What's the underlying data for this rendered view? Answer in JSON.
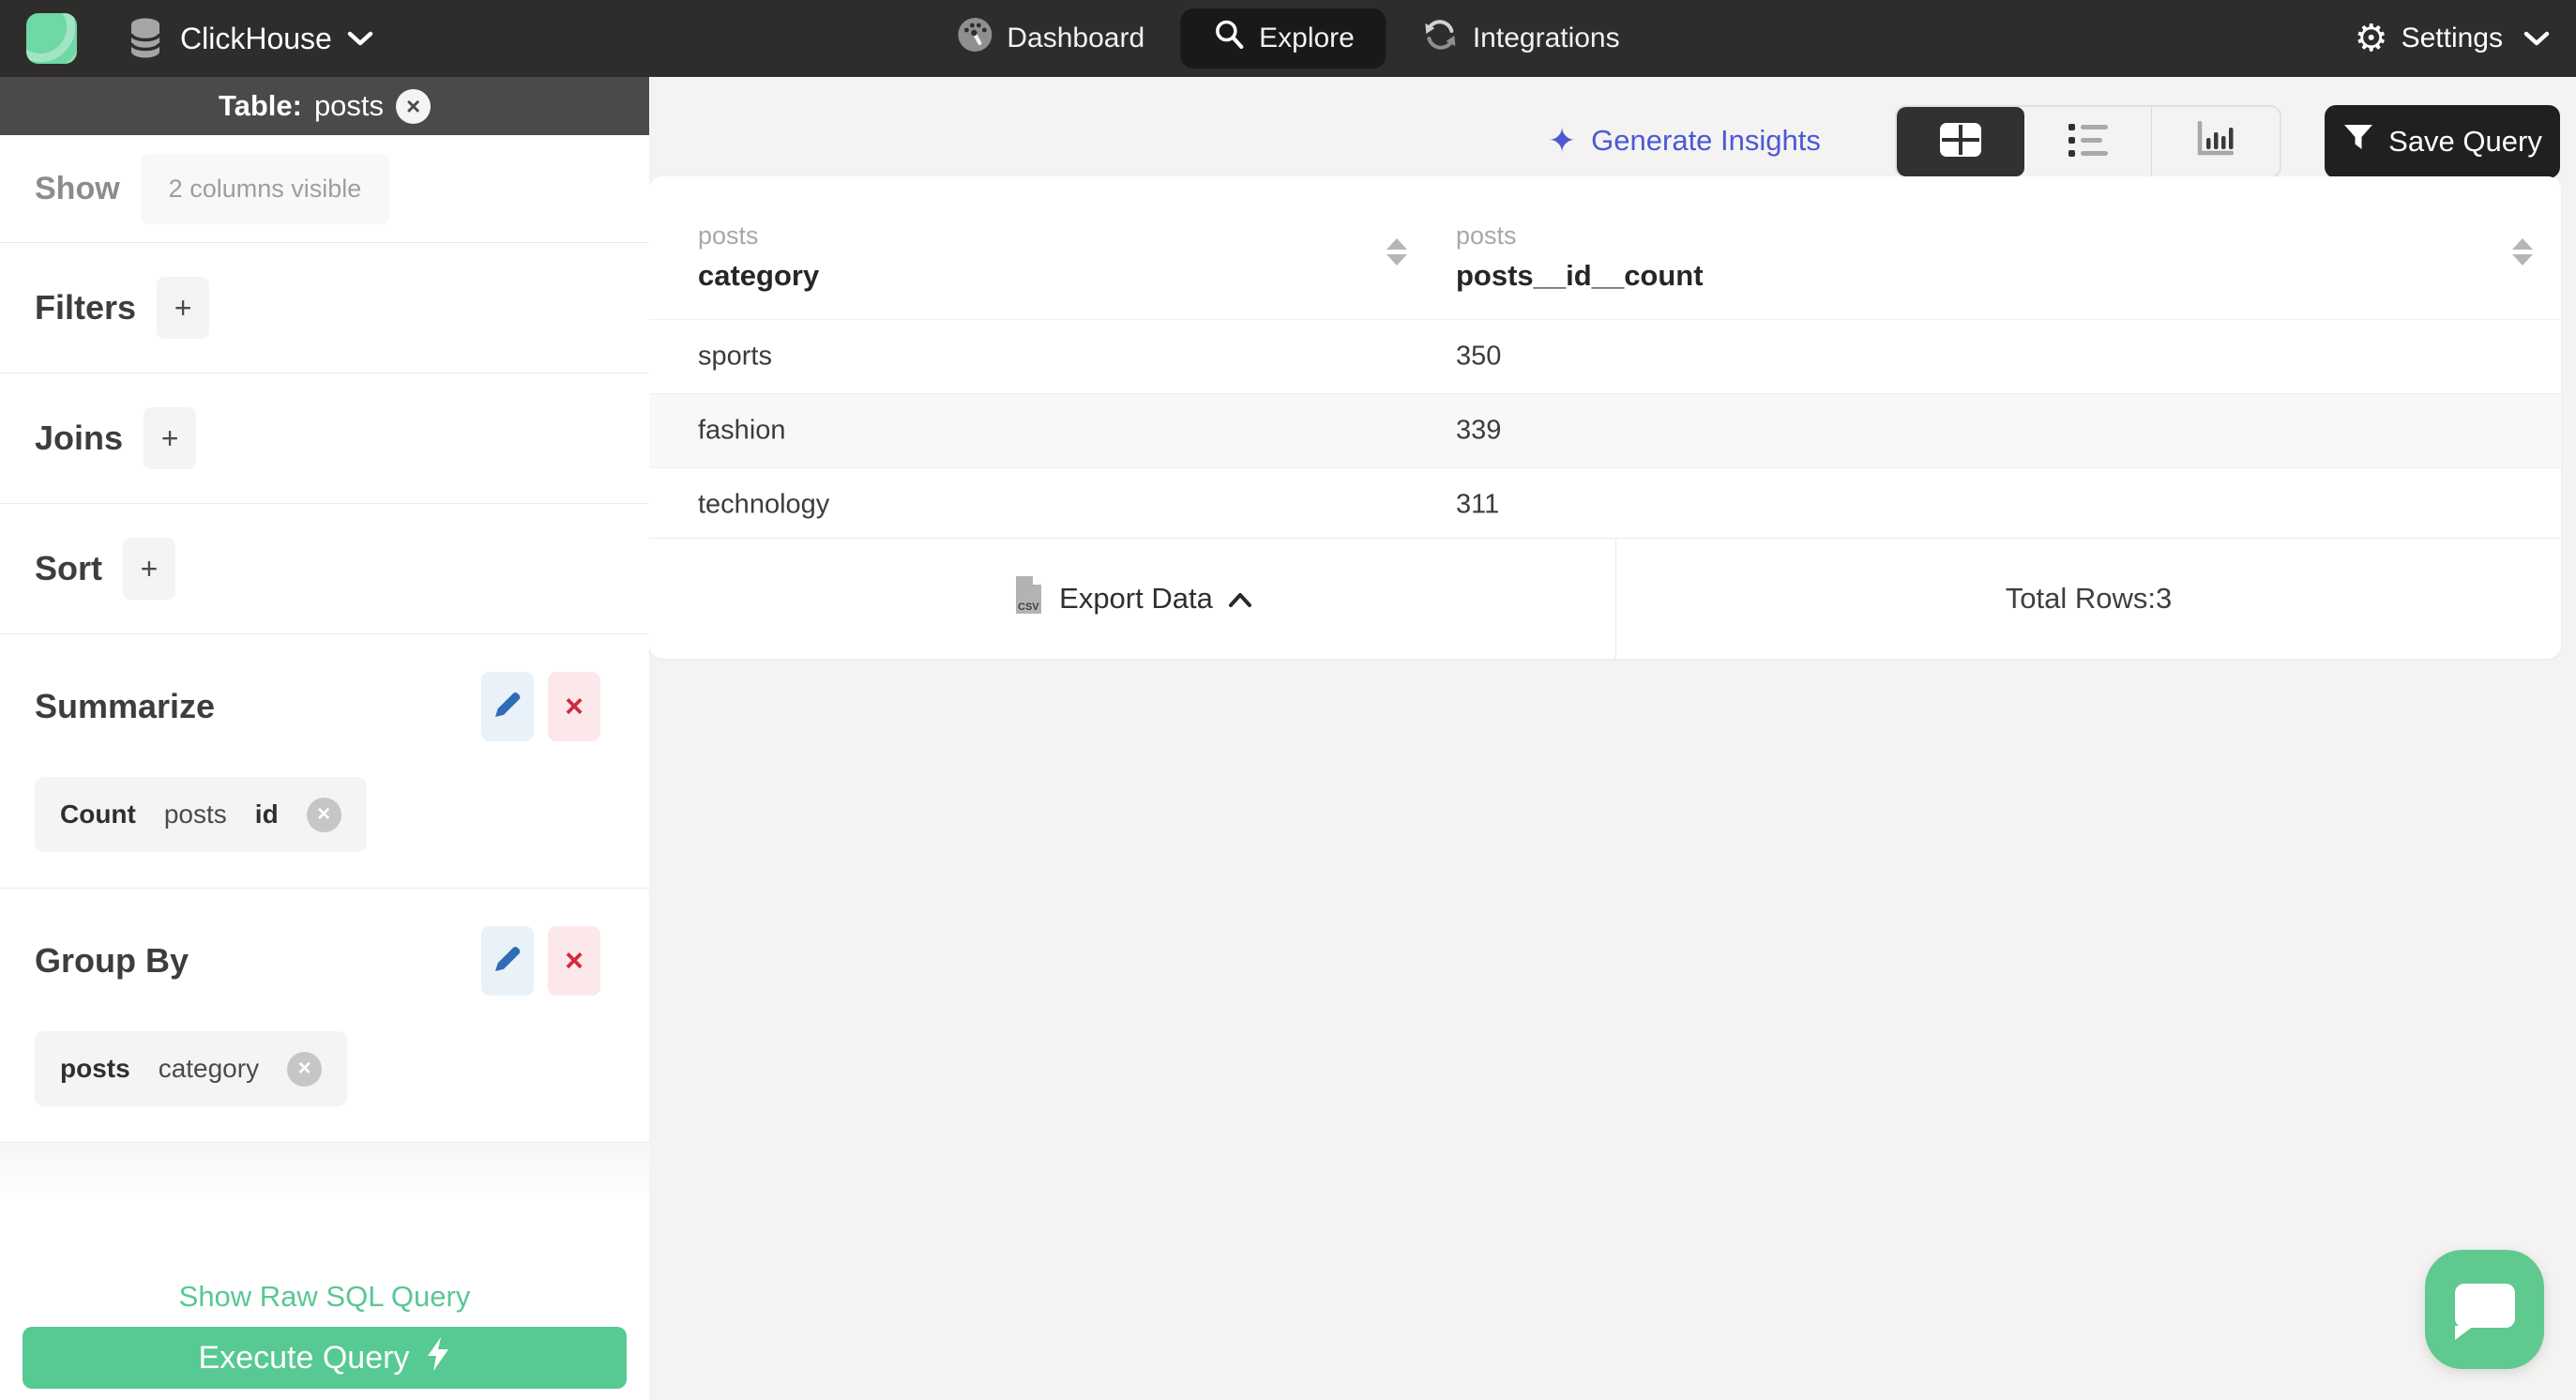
{
  "navbar": {
    "brand": {
      "name": "ClickHouse"
    },
    "nav_items": [
      {
        "label": "Dashboard",
        "active": false
      },
      {
        "label": "Explore",
        "active": true
      },
      {
        "label": "Integrations",
        "active": false
      }
    ],
    "settings_label": "Settings"
  },
  "sidebar": {
    "table_bar": {
      "label": "Table:",
      "table_name": "posts"
    },
    "show_section": {
      "label": "Show",
      "visibility_summary": "2 columns visible"
    },
    "filters_section": {
      "label": "Filters"
    },
    "joins_section": {
      "label": "Joins"
    },
    "sort_section": {
      "label": "Sort"
    },
    "summarize_section": {
      "label": "Summarize",
      "chip": {
        "aggregate": "Count",
        "table": "posts",
        "column": "id"
      }
    },
    "group_by_section": {
      "label": "Group By",
      "chip": {
        "table": "posts",
        "column": "category"
      }
    },
    "show_raw_sql_label": "Show Raw SQL Query",
    "execute_query_label": "Execute Query"
  },
  "toolbar": {
    "generate_insights_label": "Generate Insights",
    "save_query_label": "Save Query",
    "views": [
      {
        "name": "table-view",
        "active": true
      },
      {
        "name": "list-view",
        "active": false
      },
      {
        "name": "chart-view",
        "active": false
      }
    ]
  },
  "results_table": {
    "columns": [
      {
        "table": "posts",
        "name": "category"
      },
      {
        "table": "posts",
        "name": "posts__id__count"
      }
    ],
    "rows": [
      {
        "category": "sports",
        "count": "350"
      },
      {
        "category": "fashion",
        "count": "339"
      },
      {
        "category": "technology",
        "count": "311"
      }
    ],
    "export_label": "Export Data",
    "csv_icon_label": "CSV",
    "total_rows_label": "Total Rows:3"
  },
  "icons": {
    "plus_glyph": "+",
    "close_glyph": "×",
    "sparkle_glyph": "✦",
    "gear_glyph": "⚙"
  },
  "colors": {
    "navbar_bg": "#2e2d2b",
    "accent_green": "#57c993",
    "insights_indigo": "#4c59d4",
    "edit_blue": "#2e6cb5",
    "danger_red": "#cf2b3d",
    "sidebar_header_bg": "#4b4a48"
  }
}
